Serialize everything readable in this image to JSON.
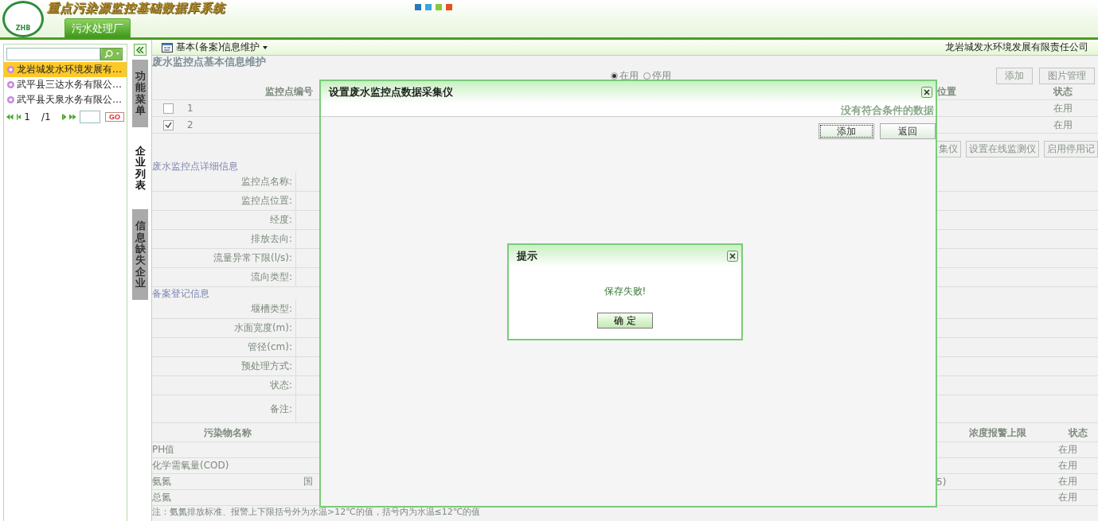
{
  "header": {
    "title": "重点污染源监控基础数据库系统",
    "logo_text": "ZHB",
    "tabs": [
      {
        "label": "污水处理厂",
        "selected": true
      }
    ]
  },
  "sidebar": {
    "companies": [
      {
        "name": "龙岩城发水环境发展有…",
        "selected": true
      },
      {
        "name": "武平县三达水务有限公…",
        "selected": false
      },
      {
        "name": "武平县天泉水务有限公…",
        "selected": false
      }
    ],
    "pager": {
      "page": "1",
      "total": "/1",
      "go": "GO"
    }
  },
  "side_tabs": [
    {
      "label": "功能菜单",
      "selected": false
    },
    {
      "label": "企业列表",
      "selected": true
    },
    {
      "label": "信息缺失企业",
      "selected": false
    }
  ],
  "toolbar": {
    "menu": "基本(备案)信息维护",
    "company": "龙岩城发水环境发展有限责任公司"
  },
  "page": {
    "section_title": "废水监控点基本信息维护",
    "status_filter": [
      {
        "label": "在用",
        "selected": true
      },
      {
        "label": "停用",
        "selected": false
      }
    ],
    "buttons": [
      "添加",
      "图片管理"
    ],
    "columns": [
      "监控点编号",
      "位置",
      "状态"
    ],
    "rows": [
      {
        "number": "1",
        "checked": false,
        "status": "在用"
      },
      {
        "number": "2",
        "checked": true,
        "status": "在用"
      }
    ],
    "actions": [
      "集仪",
      "设置在线监测仪",
      "启用停用记"
    ],
    "detail_title": "废水监控点详细信息",
    "detail_fields": [
      "监控点名称:",
      "监控点位置:",
      "经度:",
      "排放去向:",
      "流量异常下限(l/s):",
      "流向类型:"
    ],
    "record_title": "备案登记信息",
    "record_fields": [
      "堰槽类型:",
      "水面宽度(m):",
      "管径(cm):",
      "预处理方式:",
      "状态:",
      "备注:"
    ],
    "pollutant_columns": [
      "污染物名称",
      "浓度报警上限",
      "状态"
    ],
    "pollutants": [
      {
        "name": "PH值",
        "status": "在用"
      },
      {
        "name": "化学需氧量(COD)",
        "status": "在用"
      },
      {
        "name": "氨氮",
        "column_2": "国",
        "column_3": "5)",
        "status": "在用"
      },
      {
        "name": "总氮",
        "status": "在用"
      }
    ],
    "note": "注：氨氮排放标准、报警上下限括号外为水温>12℃的值，括号内为水温≤12℃的值"
  },
  "dialog": {
    "title": "设置废水监控点数据采集仪",
    "empty_message": "没有符合条件的数据",
    "buttons": [
      "添加",
      "返回"
    ]
  },
  "alert": {
    "title": "提示",
    "message": "保存失败!",
    "button": "确 定"
  }
}
